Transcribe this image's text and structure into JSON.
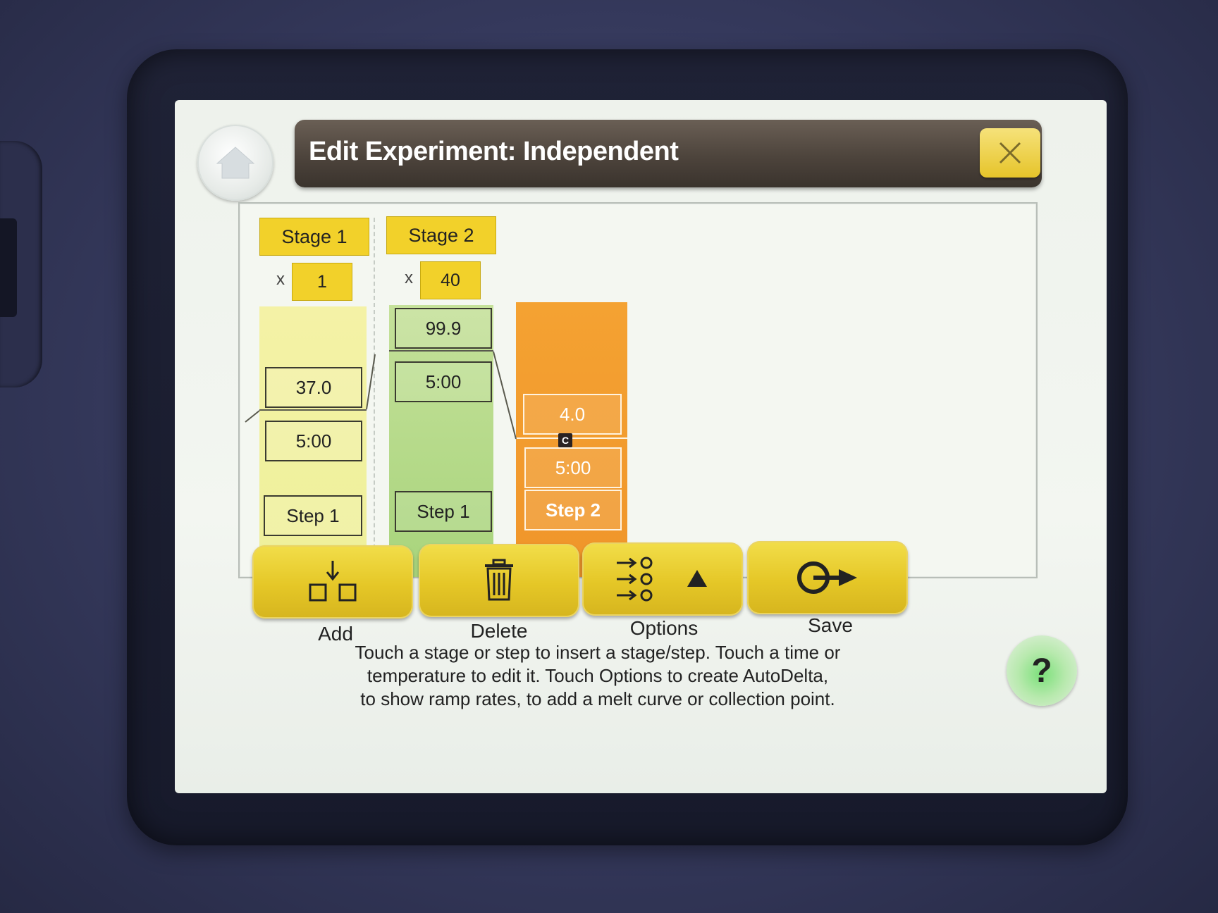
{
  "header": {
    "title": "Edit Experiment: Independent"
  },
  "stages": [
    {
      "label": "Stage 1",
      "cycles_prefix": "x",
      "cycles": "1"
    },
    {
      "label": "Stage 2",
      "cycles_prefix": "x",
      "cycles": "40"
    }
  ],
  "steps": [
    {
      "temperature": "37.0",
      "time": "5:00",
      "label": "Step 1",
      "color": "#eef09a"
    },
    {
      "temperature": "99.9",
      "time": "5:00",
      "label": "Step 1",
      "color": "#a8d47c"
    },
    {
      "temperature": "4.0",
      "time": "5:00",
      "label": "Step 2",
      "color": "#f0952a",
      "collection_badge": "C"
    }
  ],
  "toolbar": {
    "add_label": "Add",
    "delete_label": "Delete",
    "options_label": "Options",
    "save_label": "Save"
  },
  "help": {
    "line1": "Touch a stage or step to insert a stage/step. Touch a time or",
    "line2": "temperature to edit it. Touch Options to create AutoDelta,",
    "line3": "to show ramp rates, to add a melt curve or collection point.",
    "button_label": "?"
  },
  "colors": {
    "accent_yellow": "#f2d12a",
    "title_bar": "#4d443c",
    "help_green": "#7be07a"
  }
}
